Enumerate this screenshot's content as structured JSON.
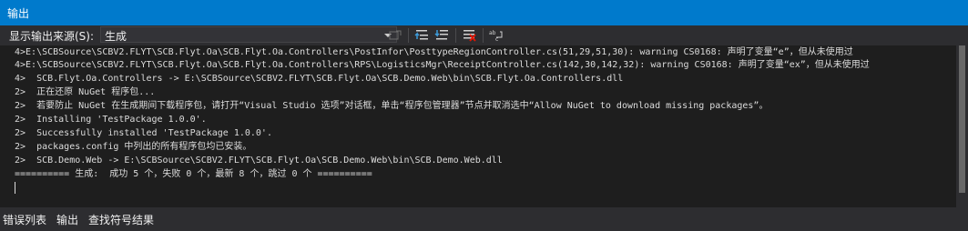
{
  "window": {
    "title": "输出"
  },
  "toolbar": {
    "source_label": "显示输出来源(S):",
    "source_value": "生成",
    "icons": [
      "find-message-in-code",
      "previous-message",
      "next-message",
      "clear-all",
      "toggle-word-wrap"
    ]
  },
  "output": {
    "lines": [
      "4>E:\\SCBSource\\SCBV2.FLYT\\SCB.Flyt.Oa\\SCB.Flyt.Oa.Controllers\\PostInfor\\PosttypeRegionController.cs(51,29,51,30): warning CS0168: 声明了变量“e”，但从未使用过",
      "4>E:\\SCBSource\\SCBV2.FLYT\\SCB.Flyt.Oa\\SCB.Flyt.Oa.Controllers\\RPS\\LogisticsMgr\\ReceiptController.cs(142,30,142,32): warning CS0168: 声明了变量“ex”，但从未使用过",
      "4>  SCB.Flyt.Oa.Controllers -> E:\\SCBSource\\SCBV2.FLYT\\SCB.Flyt.Oa\\SCB.Demo.Web\\bin\\SCB.Flyt.Oa.Controllers.dll",
      "2>  正在还原 NuGet 程序包...",
      "2>  若要防止 NuGet 在生成期间下载程序包，请打开“Visual Studio 选项”对话框，单击“程序包管理器”节点并取消选中“Allow NuGet to download missing packages”。",
      "2>  Installing 'TestPackage 1.0.0'.",
      "2>  Successfully installed 'TestPackage 1.0.0'.",
      "2>  packages.config 中列出的所有程序包均已安装。",
      "2>  SCB.Demo.Web -> E:\\SCBSource\\SCBV2.FLYT\\SCB.Flyt.Oa\\SCB.Demo.Web\\bin\\SCB.Demo.Web.dll",
      "========== 生成:  成功 5 个，失败 0 个，最新 8 个，跳过 0 个 =========="
    ]
  },
  "bottom_tabs": [
    "错误列表",
    "输出",
    "查找符号结果"
  ],
  "colors": {
    "title_bar": "#007acc",
    "chrome": "#2d2d30",
    "output_bg": "#1e1e1e",
    "text": "#dcdcdc"
  }
}
